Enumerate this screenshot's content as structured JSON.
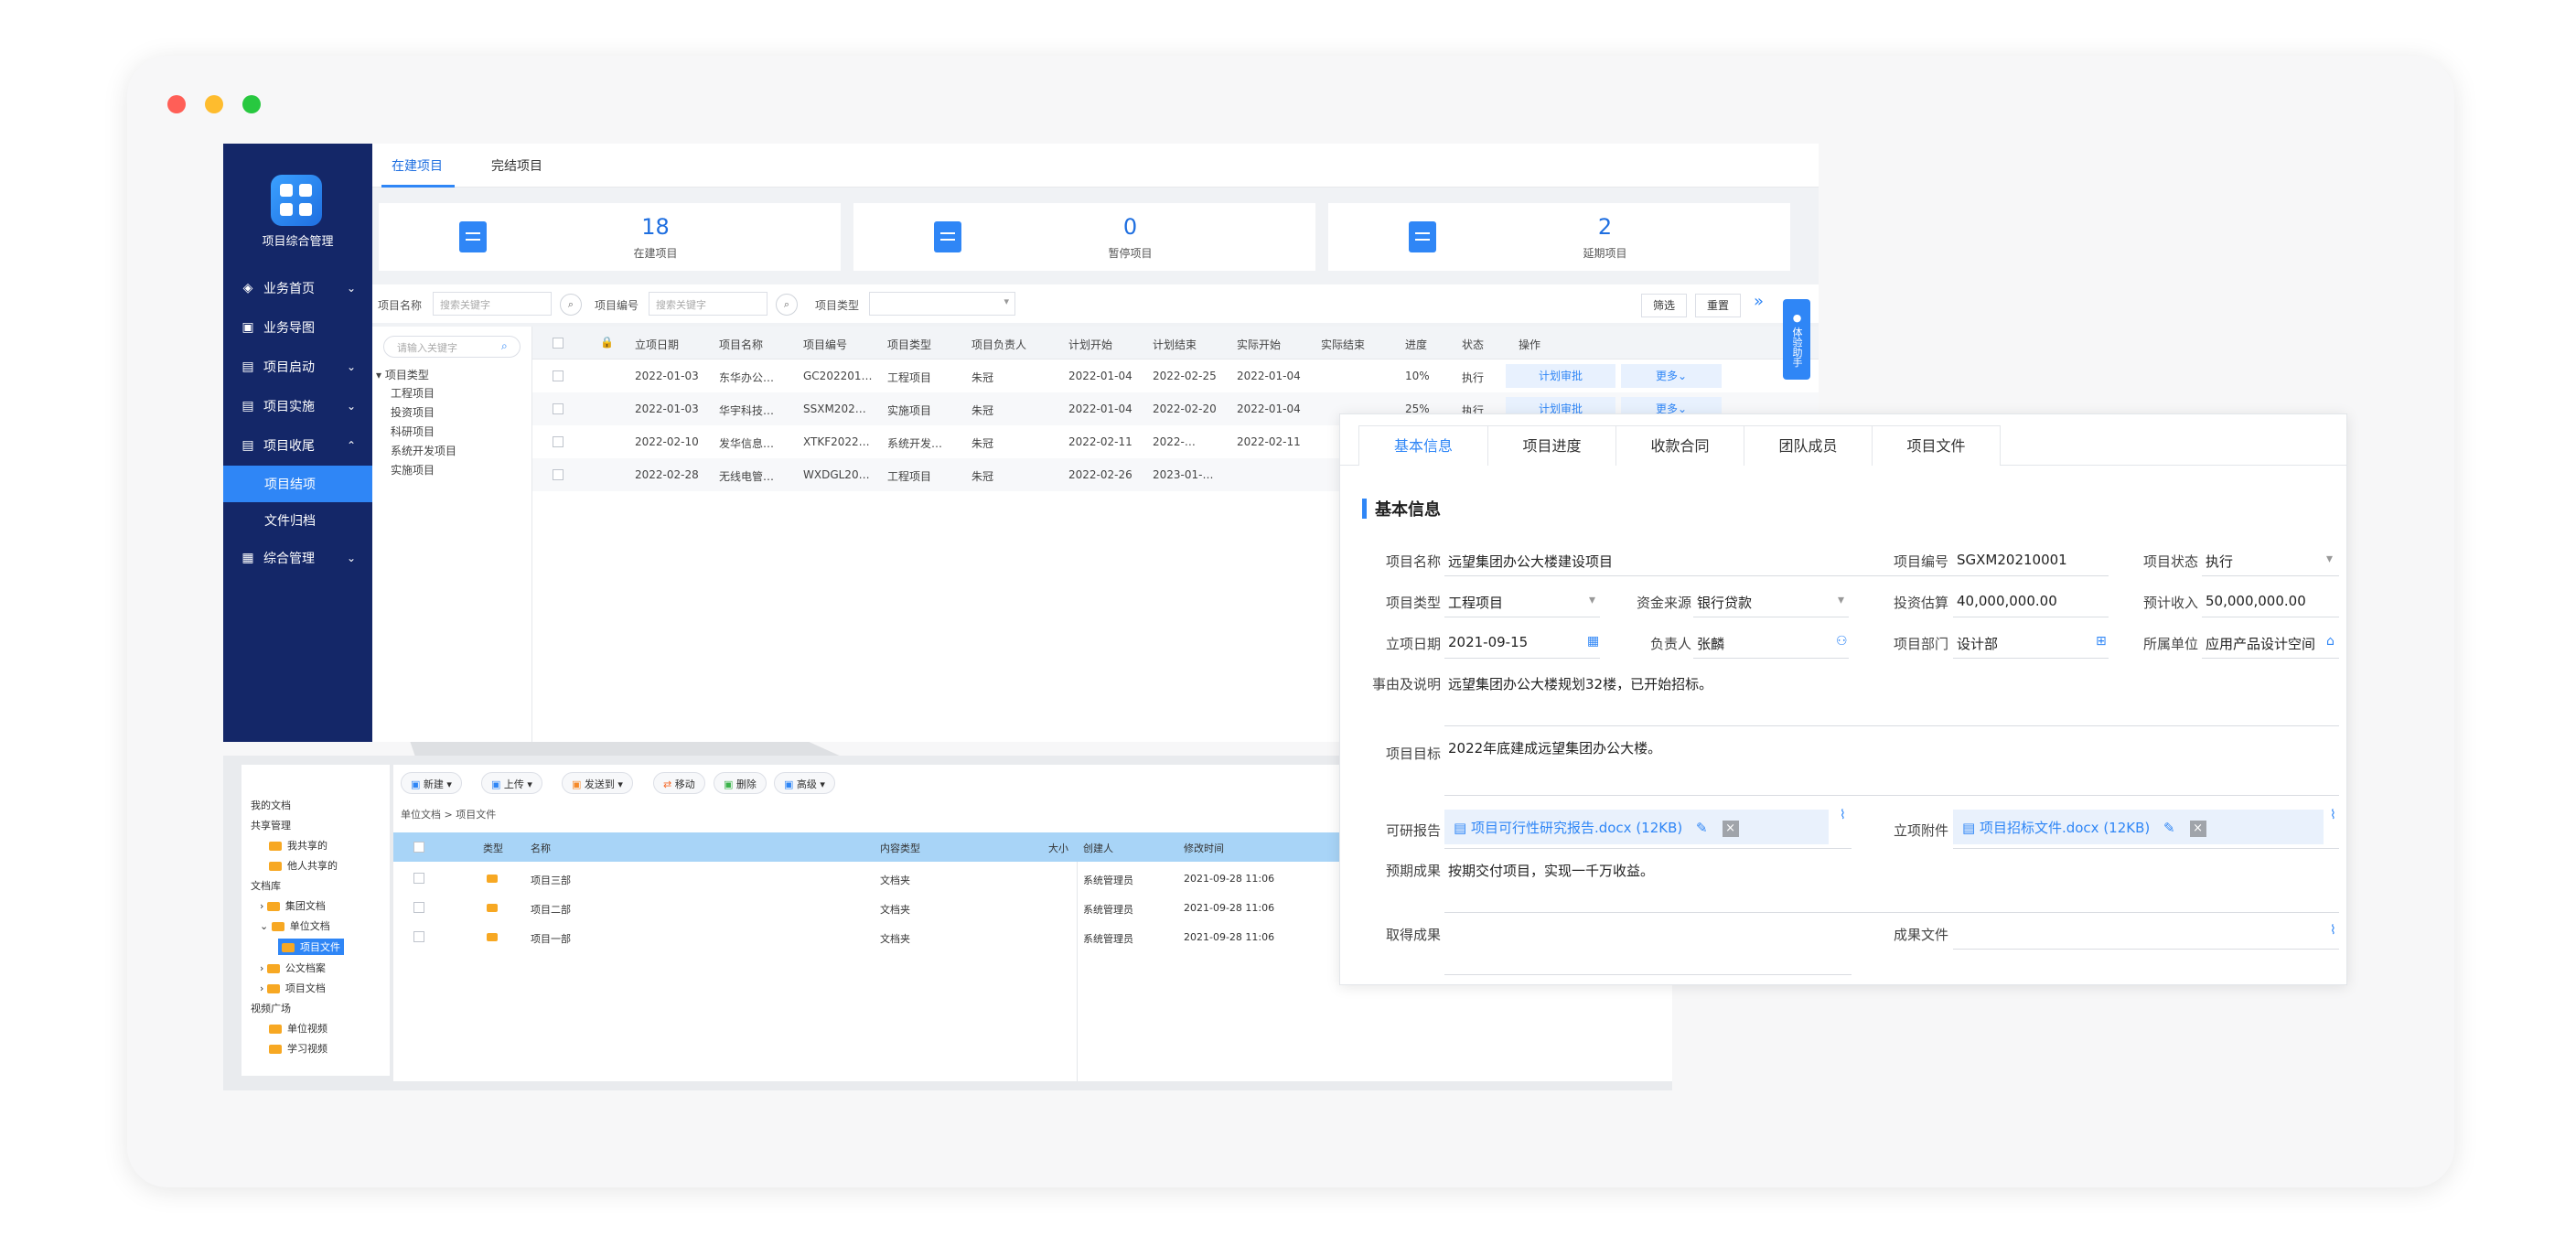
{
  "sidebar": {
    "app_name": "项目综合管理",
    "items": [
      {
        "label": "业务首页",
        "icon": "layers-icon",
        "chevron": "⌄"
      },
      {
        "label": "业务导图",
        "icon": "map-icon",
        "chevron": ""
      },
      {
        "label": "项目启动",
        "icon": "file-icon",
        "chevron": "⌄"
      },
      {
        "label": "项目实施",
        "icon": "file-icon",
        "chevron": "⌄"
      },
      {
        "label": "项目收尾",
        "icon": "file-icon",
        "chevron": "⌃"
      },
      {
        "label": "项目结项",
        "icon": "",
        "chevron": ""
      },
      {
        "label": "文件归档",
        "icon": "",
        "chevron": ""
      },
      {
        "label": "综合管理",
        "icon": "chart-icon",
        "chevron": "⌄"
      }
    ]
  },
  "tabs": [
    "在建项目",
    "完结项目"
  ],
  "stats": [
    {
      "value": "18",
      "label": "在建项目"
    },
    {
      "value": "0",
      "label": "暂停项目"
    },
    {
      "value": "2",
      "label": "延期项目"
    }
  ],
  "filters": {
    "name_label": "项目名称",
    "name_placeholder": "搜索关键字",
    "code_label": "项目编号",
    "code_placeholder": "搜索关键字",
    "type_label": "项目类型",
    "filter_btn": "筛选",
    "reset_btn": "重置"
  },
  "tree": {
    "search_placeholder": "请输入关键字",
    "root": "项目类型",
    "items": [
      "工程项目",
      "投资项目",
      "科研项目",
      "系统开发项目",
      "实施项目"
    ]
  },
  "helper_label": "体验助手",
  "table": {
    "headers": [
      "立项日期",
      "项目名称",
      "项目编号",
      "项目类型",
      "项目负责人",
      "计划开始",
      "计划结束",
      "实际开始",
      "实际结束",
      "进度",
      "状态",
      "操作"
    ],
    "rows": [
      [
        "2022-01-03",
        "东华办公…",
        "GC202201…",
        "工程项目",
        "朱冠",
        "2022-01-04",
        "2022-02-25",
        "2022-01-04",
        "",
        "10%",
        "执行"
      ],
      [
        "2022-01-03",
        "华宇科技…",
        "SSXM202…",
        "实施项目",
        "朱冠",
        "2022-01-04",
        "2022-02-20",
        "2022-01-04",
        "",
        "25%",
        "执行"
      ],
      [
        "2022-02-10",
        "发华信息…",
        "XTKF2022…",
        "系统开发…",
        "朱冠",
        "2022-02-11",
        "2022-…",
        "2022-02-11",
        "",
        "",
        ""
      ],
      [
        "2022-02-28",
        "无线电管…",
        "WXDGL20…",
        "工程项目",
        "朱冠",
        "2022-02-26",
        "2023-01-…",
        "",
        "",
        "",
        ""
      ]
    ],
    "op_primary": "计划审批",
    "op_more": "更多⌄"
  },
  "docs": {
    "tree": {
      "my": "我的文档",
      "shared": "共享管理",
      "shared_items": [
        "我共享的",
        "他人共享的"
      ],
      "lib": "文档库",
      "lib_items": [
        "集团文档",
        "单位文档"
      ],
      "selected": "项目文件",
      "more_items": [
        "公文档案",
        "项目文档"
      ],
      "video": "视频广场",
      "video_items": [
        "单位视频",
        "学习视频"
      ]
    },
    "toolbar": [
      "新建 ▾",
      "上传 ▾",
      "发送到 ▾",
      "移动",
      "删除",
      "高级 ▾"
    ],
    "breadcrumb": "单位文档 > 项目文件",
    "headers": [
      "类型",
      "名称",
      "内容类型",
      "大小",
      "创建人",
      "修改时间"
    ],
    "rows": [
      {
        "name": "项目三部",
        "ctype": "文档夹",
        "creator": "系统管理员",
        "time": "2021-09-28 11:06"
      },
      {
        "name": "项目二部",
        "ctype": "文档夹",
        "creator": "系统管理员",
        "time": "2021-09-28 11:06"
      },
      {
        "name": "项目一部",
        "ctype": "文档夹",
        "creator": "系统管理员",
        "time": "2021-09-28 11:06"
      }
    ]
  },
  "detail": {
    "tabs": [
      "基本信息",
      "项目进度",
      "收款合同",
      "团队成员",
      "项目文件"
    ],
    "section": "基本信息",
    "fields": {
      "name_label": "项目名称",
      "name": "远望集团办公大楼建设项目",
      "code_label": "项目编号",
      "code": "SGXM20210001",
      "status_label": "项目状态",
      "status": "执行",
      "type_label": "项目类型",
      "type": "工程项目",
      "fund_label": "资金来源",
      "fund": "银行贷款",
      "budget_label": "投资估算",
      "budget": "40,000,000.00",
      "income_label": "预计收入",
      "income": "50,000,000.00",
      "date_label": "立项日期",
      "date": "2021-09-15",
      "owner_label": "负责人",
      "owner": "张麟",
      "dept_label": "项目部门",
      "dept": "设计部",
      "unit_label": "所属单位",
      "unit": "应用产品设计空间",
      "reason_label": "事由及说明",
      "reason": "远望集团办公大楼规划32楼，已开始招标。",
      "goal_label": "项目目标",
      "goal": "2022年底建成远望集团办公大楼。",
      "report_label": "可研报告",
      "report_file": "项目可行性研究报告.docx (12KB)",
      "attach_label": "立项附件",
      "attach_file": "项目招标文件.docx (12KB)",
      "expected_label": "预期成果",
      "expected": "按期交付项目，实现一千万收益。",
      "achieved_label": "取得成果",
      "result_file_label": "成果文件"
    }
  }
}
